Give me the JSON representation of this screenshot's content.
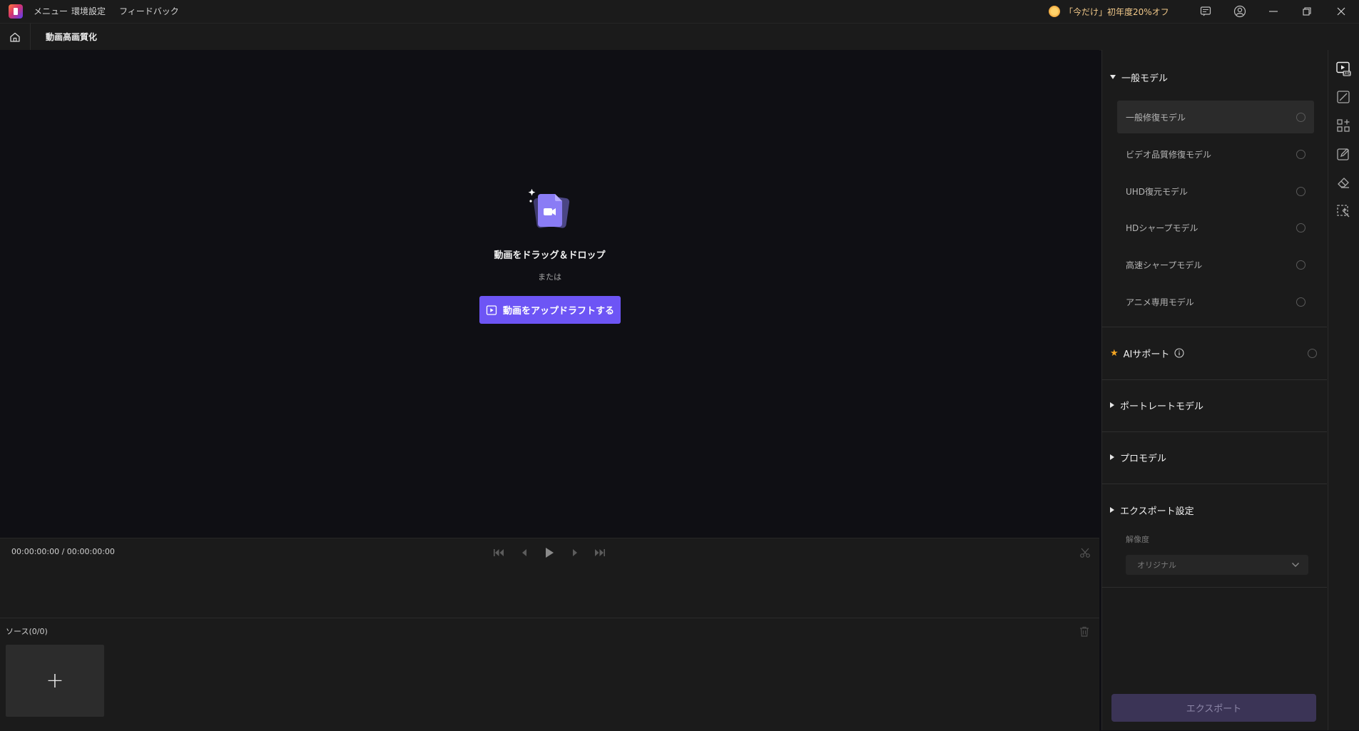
{
  "titlebar": {
    "menu": [
      "メニュー",
      "環境設定",
      "フィードバック"
    ],
    "promo": "「今だけ」初年度20%オフ"
  },
  "header": {
    "title": "動画高画質化"
  },
  "preview": {
    "drop_title": "動画をドラッグ＆ドロップ",
    "or_text": "または",
    "upload_label": "動画をアップドラフトする"
  },
  "playback": {
    "timecode": "00:00:00:00 / 00:00:00:00"
  },
  "source": {
    "label": "ソース(0/0)",
    "add_symbol": "+"
  },
  "panel": {
    "general": {
      "heading": "一般モデル",
      "models": [
        "一般修復モデル",
        "ビデオ品質修復モデル",
        "UHD復元モデル",
        "HDシャープモデル",
        "高速シャープモデル",
        "アニメ専用モデル"
      ],
      "selected_index": 0
    },
    "ai_support": {
      "label": "AIサポート"
    },
    "portrait": {
      "heading": "ポートレートモデル"
    },
    "pro": {
      "heading": "プロモデル"
    },
    "export_settings": {
      "heading": "エクスポート設定",
      "resolution_label": "解像度",
      "resolution_value": "オリジナル"
    },
    "export_button": "エクスポート"
  },
  "colors": {
    "accent": "#6d55f5",
    "export_disabled": "#3b3456",
    "star": "#f5a623"
  },
  "icons": {
    "rail": [
      "uhd-video-icon",
      "curve-icon",
      "apps-icon",
      "edit-icon",
      "eraser-icon",
      "select-magic-icon"
    ]
  }
}
